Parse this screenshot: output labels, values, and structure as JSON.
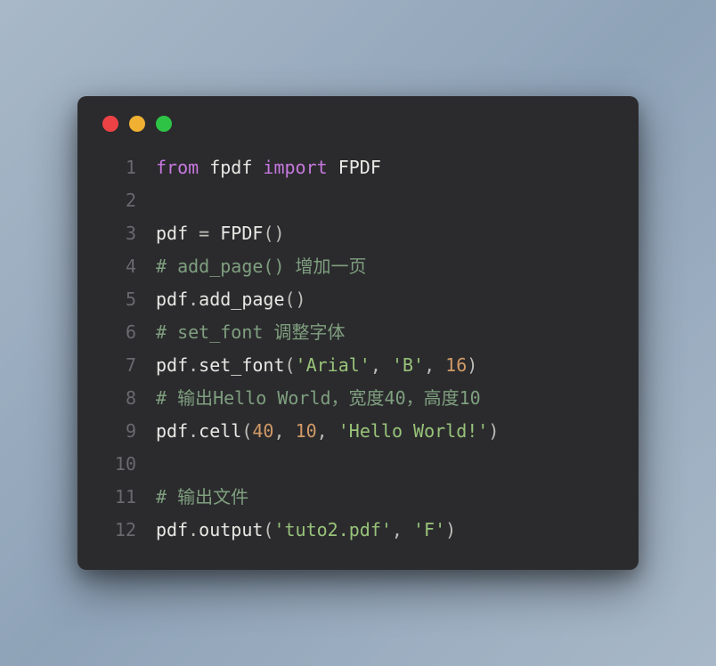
{
  "window": {
    "dots": {
      "red": "#ed4245",
      "yellow": "#f0b132",
      "green": "#2ec345"
    }
  },
  "code": {
    "lines": [
      {
        "n": "1",
        "tokens": [
          [
            "kw",
            "from"
          ],
          [
            "",
            " fpdf "
          ],
          [
            "kw",
            "import"
          ],
          [
            "",
            " FPDF"
          ]
        ]
      },
      {
        "n": "2",
        "tokens": []
      },
      {
        "n": "3",
        "tokens": [
          [
            "",
            "pdf "
          ],
          [
            "pun",
            "="
          ],
          [
            "",
            " FPDF"
          ],
          [
            "pun",
            "()"
          ]
        ]
      },
      {
        "n": "4",
        "tokens": [
          [
            "com",
            "# add_page() 增加一页"
          ]
        ]
      },
      {
        "n": "5",
        "tokens": [
          [
            "",
            "pdf"
          ],
          [
            "pun",
            "."
          ],
          [
            "fn",
            "add_page"
          ],
          [
            "pun",
            "()"
          ]
        ]
      },
      {
        "n": "6",
        "tokens": [
          [
            "com",
            "# set_font 调整字体"
          ]
        ]
      },
      {
        "n": "7",
        "tokens": [
          [
            "",
            "pdf"
          ],
          [
            "pun",
            "."
          ],
          [
            "fn",
            "set_font"
          ],
          [
            "pun",
            "("
          ],
          [
            "str",
            "'Arial'"
          ],
          [
            "pun",
            ", "
          ],
          [
            "str",
            "'B'"
          ],
          [
            "pun",
            ", "
          ],
          [
            "num",
            "16"
          ],
          [
            "pun",
            ")"
          ]
        ]
      },
      {
        "n": "8",
        "tokens": [
          [
            "com",
            "# 输出Hello World，宽度40，高度10"
          ]
        ]
      },
      {
        "n": "9",
        "tokens": [
          [
            "",
            "pdf"
          ],
          [
            "pun",
            "."
          ],
          [
            "fn",
            "cell"
          ],
          [
            "pun",
            "("
          ],
          [
            "num",
            "40"
          ],
          [
            "pun",
            ", "
          ],
          [
            "num",
            "10"
          ],
          [
            "pun",
            ", "
          ],
          [
            "str",
            "'Hello World!'"
          ],
          [
            "pun",
            ")"
          ]
        ]
      },
      {
        "n": "10",
        "tokens": []
      },
      {
        "n": "11",
        "tokens": [
          [
            "com",
            "# 输出文件"
          ]
        ]
      },
      {
        "n": "12",
        "tokens": [
          [
            "",
            "pdf"
          ],
          [
            "pun",
            "."
          ],
          [
            "fn",
            "output"
          ],
          [
            "pun",
            "("
          ],
          [
            "str",
            "'tuto2.pdf'"
          ],
          [
            "pun",
            ", "
          ],
          [
            "str",
            "'F'"
          ],
          [
            "pun",
            ")"
          ]
        ]
      }
    ]
  }
}
